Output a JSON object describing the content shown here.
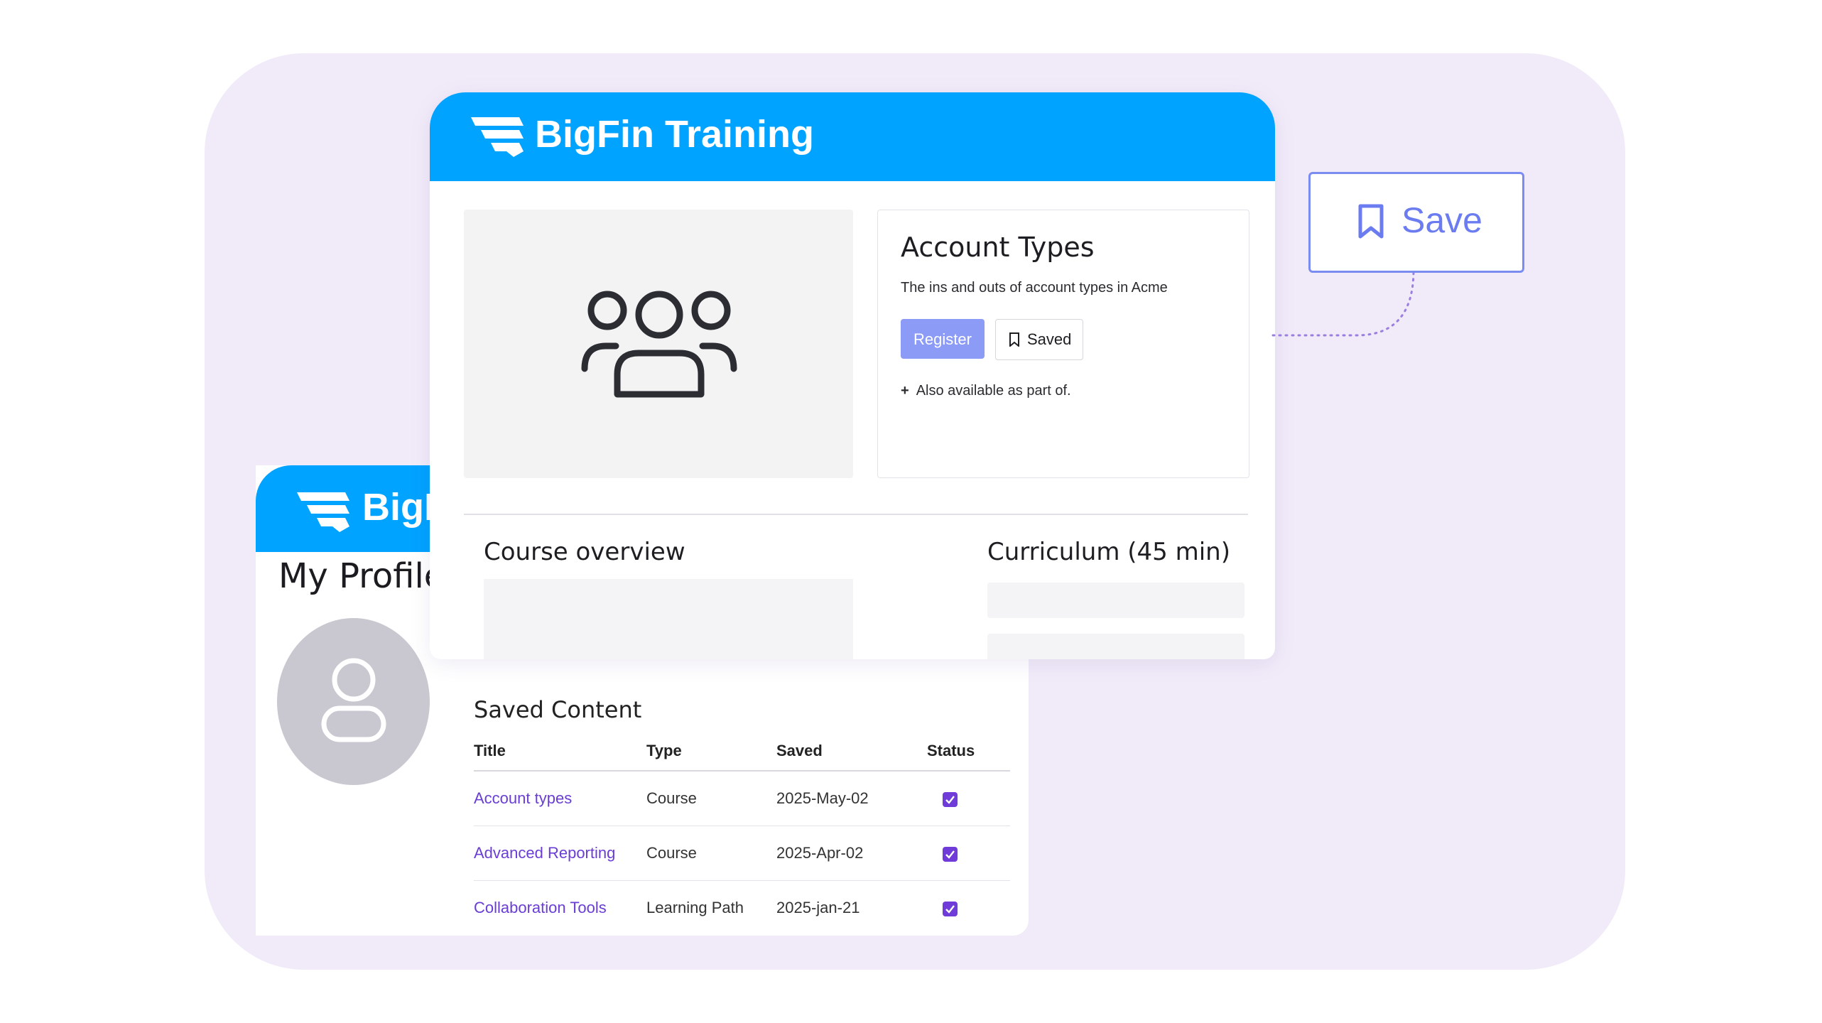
{
  "brand": {
    "name": "BigFin Training",
    "partial_name": "BigF",
    "color": "#00a3ff"
  },
  "course": {
    "title": "Account Types",
    "description": "The ins and outs of account types in Acme",
    "register_label": "Register",
    "saved_label": "Saved",
    "also_available": "Also available as part of.",
    "overview_heading": "Course overview",
    "curriculum_heading": "Curriculum (45 min)",
    "image_icon": "users-group-icon"
  },
  "callout": {
    "save_label": "Save",
    "icon": "bookmark-icon"
  },
  "profile": {
    "title": "My Profile",
    "avatar_icon": "user-icon",
    "saved_content": {
      "heading": "Saved Content",
      "columns": [
        "Title",
        "Type",
        "Saved",
        "Status"
      ],
      "rows": [
        {
          "title": "Account types",
          "type": "Course",
          "saved": "2025-May-02",
          "status": true
        },
        {
          "title": "Advanced Reporting",
          "type": "Course",
          "saved": "2025-Apr-02",
          "status": true
        },
        {
          "title": "Collaboration Tools",
          "type": "Learning Path",
          "saved": "2025-jan-21",
          "status": true
        }
      ]
    }
  },
  "colors": {
    "accent": "#6f3bd9",
    "register": "#8c9bf6",
    "save_callout": "#7b8cf0",
    "background": "#f1ebf9"
  }
}
